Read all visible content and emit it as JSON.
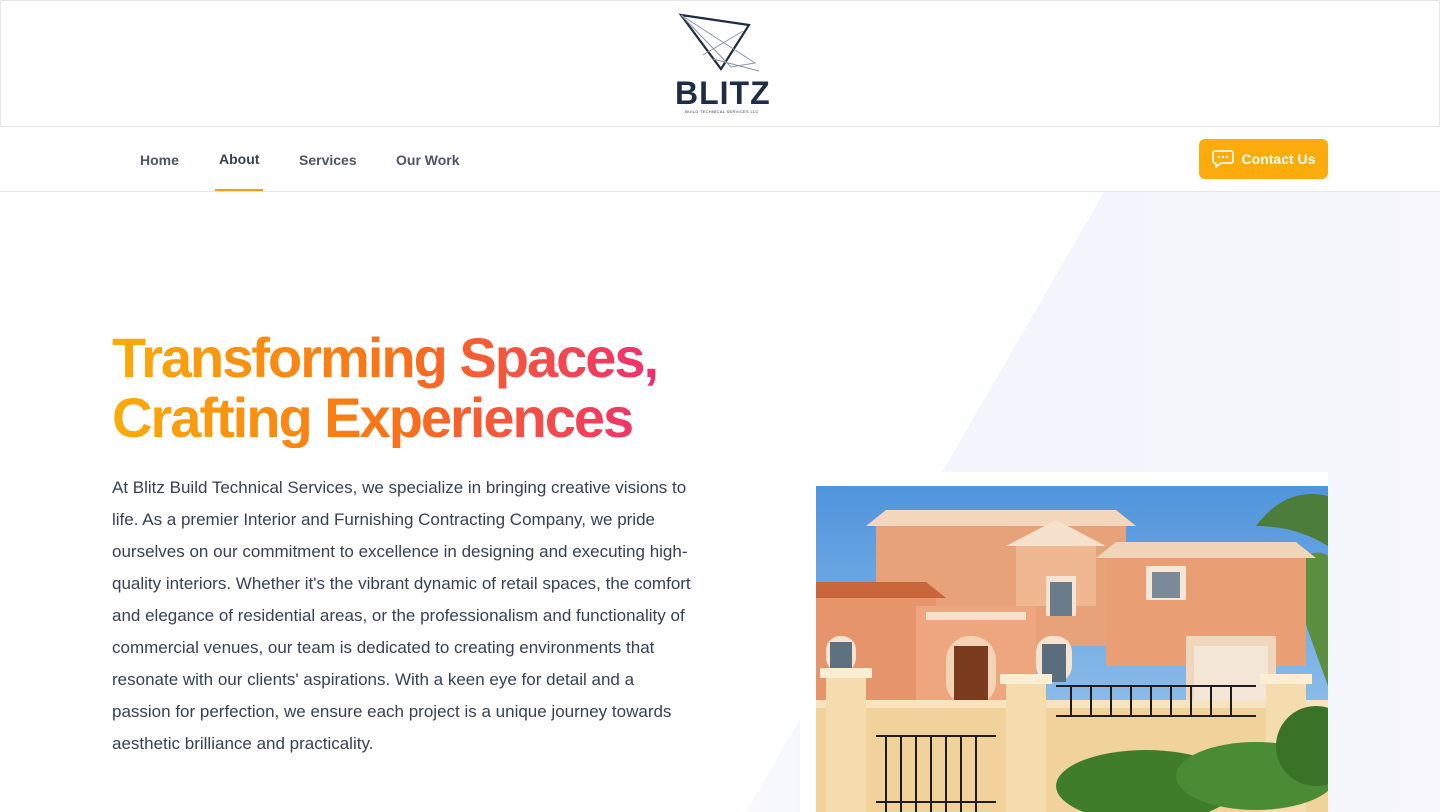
{
  "brand": {
    "name": "BLITZ",
    "tagline": "BUILD TECHNICAL SERVICES LLC"
  },
  "nav": {
    "items": [
      {
        "label": "Home",
        "active": false
      },
      {
        "label": "About",
        "active": true
      },
      {
        "label": "Services",
        "active": false
      },
      {
        "label": "Our Work",
        "active": false
      }
    ],
    "contact_label": "Contact Us",
    "contact_icon": "chat-bubble-icon"
  },
  "hero": {
    "title_line1": "Transforming Spaces,",
    "title_line2": "Crafting Experiences",
    "paragraph": "At Blitz Build Technical Services, we specialize in bringing creative visions to life. As a premier Interior and Furnishing Contracting Company, we pride ourselves on our commitment to excellence in designing and executing high-quality interiors. Whether it's the vibrant dynamic of retail spaces, the comfort and elegance of residential areas, or the professionalism and functionality of commercial venues, our team is dedicated to creating environments that resonate with our clients' aspirations. With a keen eye for detail and a passion for perfection, we ensure each project is a unique journey towards aesthetic brilliance and practicality.",
    "image": "villa-photo"
  },
  "colors": {
    "accent": "#fbab0b",
    "gradient_start": "#fbab0b",
    "gradient_mid": "#f97316",
    "gradient_end": "#ec1b8a",
    "logo_navy": "#1f2d44"
  }
}
